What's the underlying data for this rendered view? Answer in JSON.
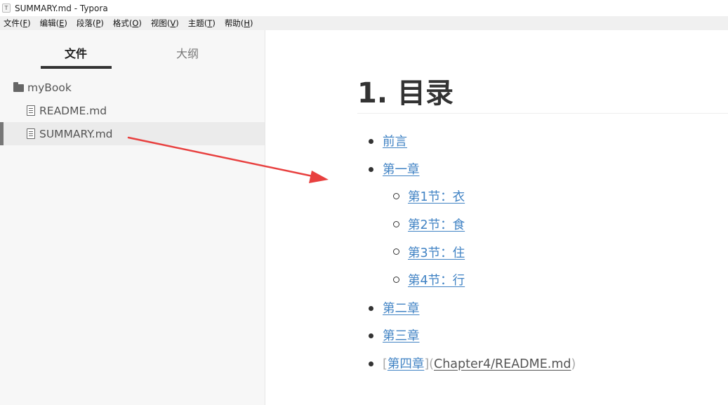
{
  "window": {
    "title": "SUMMARY.md - Typora",
    "app_icon_glyph": "T"
  },
  "menu": [
    {
      "label": "文件(",
      "acc": "F",
      "end": ")"
    },
    {
      "label": "编辑(",
      "acc": "E",
      "end": ")"
    },
    {
      "label": "段落(",
      "acc": "P",
      "end": ")"
    },
    {
      "label": "格式(",
      "acc": "O",
      "end": ")"
    },
    {
      "label": "视图(",
      "acc": "V",
      "end": ")"
    },
    {
      "label": "主题(",
      "acc": "T",
      "end": ")"
    },
    {
      "label": "帮助(",
      "acc": "H",
      "end": ")"
    }
  ],
  "sidebar": {
    "tabs": {
      "files": "文件",
      "outline": "大纲"
    },
    "tree": {
      "folder": "myBook",
      "files": [
        "README.md",
        "SUMMARY.md"
      ],
      "active_file": "SUMMARY.md"
    }
  },
  "editor": {
    "heading": "1. 目录",
    "items": [
      {
        "text": "前言"
      },
      {
        "text": "第一章"
      },
      {
        "text": "第1节：衣"
      },
      {
        "text": "第2节：食"
      },
      {
        "text": "第3节：住"
      },
      {
        "text": "第4节：行"
      },
      {
        "text": "第二章"
      },
      {
        "text": "第三章"
      }
    ],
    "raw_item": {
      "open_bracket": "[",
      "text": "第四章",
      "close_open": "](",
      "target": "Chapter4/README.md",
      "close_paren": ")"
    }
  },
  "colors": {
    "link": "#4183c4",
    "annotation_arrow": "#e8403f"
  }
}
